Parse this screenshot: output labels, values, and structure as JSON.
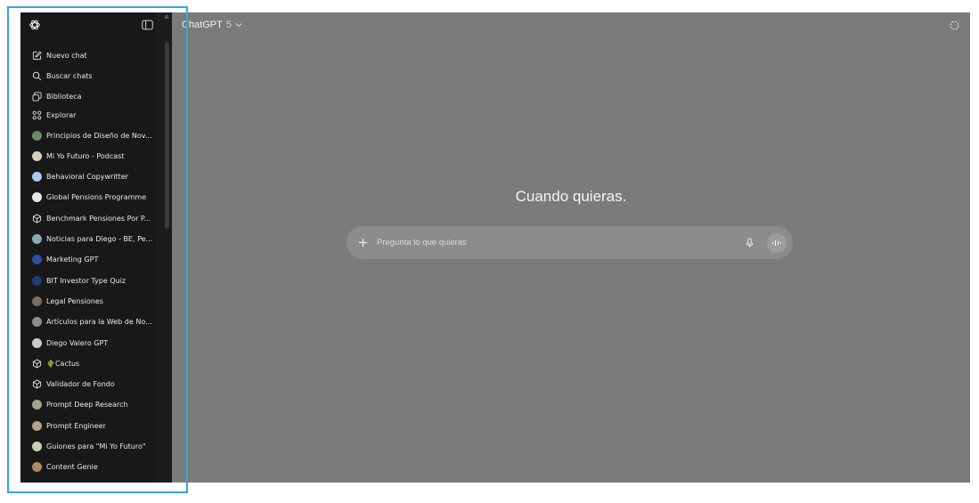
{
  "header": {
    "model_name": "ChatGPT",
    "model_version": "5"
  },
  "sidebar": {
    "nav": [
      {
        "label": "Nuevo chat",
        "icon": "new-chat-icon"
      },
      {
        "label": "Buscar chats",
        "icon": "search-icon"
      },
      {
        "label": "Biblioteca",
        "icon": "library-icon"
      },
      {
        "label": "Explorar",
        "icon": "explore-icon"
      }
    ],
    "gpts": [
      {
        "label": "Principios de Diseño de Nov...",
        "avatar_color": "#6f8a6a"
      },
      {
        "label": "Mi Yo Futuro - Podcast",
        "avatar_color": "#d8d0c0"
      },
      {
        "label": "Behavioral Copywritter",
        "avatar_color": "#a9c7f2"
      },
      {
        "label": "Global Pensions Programme",
        "avatar_color": "#e6e6e6"
      },
      {
        "label": "Benchmark Pensiones Por P...",
        "avatar_color": "outline"
      },
      {
        "label": "Noticias para Diego - BE, Pe...",
        "avatar_color": "#8ea7b3"
      },
      {
        "label": "Marketing GPT",
        "avatar_color": "#2b4fa2"
      },
      {
        "label": "BIT Investor Type Quiz",
        "avatar_color": "#1d3e7a"
      },
      {
        "label": "Legal Pensiones",
        "avatar_color": "#7d6c60"
      },
      {
        "label": "Artículos para la Web de No...",
        "avatar_color": "#8a8f8a"
      },
      {
        "label": "Diego Valero GPT",
        "avatar_color": "#c9c9c9"
      },
      {
        "label": "🌵Cactus",
        "avatar_color": "outline"
      },
      {
        "label": "Validador de Fondo",
        "avatar_color": "outline"
      },
      {
        "label": "Prompt Deep Research",
        "avatar_color": "#9aa88a"
      },
      {
        "label": "Prompt Engineer",
        "avatar_color": "#b2a58c"
      },
      {
        "label": "Guiones para \"Mi Yo Futuro\"",
        "avatar_color": "#c8d0b8"
      },
      {
        "label": "Content Genie",
        "avatar_color": "#b08a62"
      }
    ]
  },
  "main": {
    "hero_text": "Cuando quieras.",
    "composer": {
      "placeholder": "Pregunta lo que quieras"
    }
  },
  "colors": {
    "sidebar_bg": "#181818",
    "main_bg": "#7b7b7b",
    "composer_bg": "#8c8c8c",
    "highlight": "#2fa8df"
  }
}
